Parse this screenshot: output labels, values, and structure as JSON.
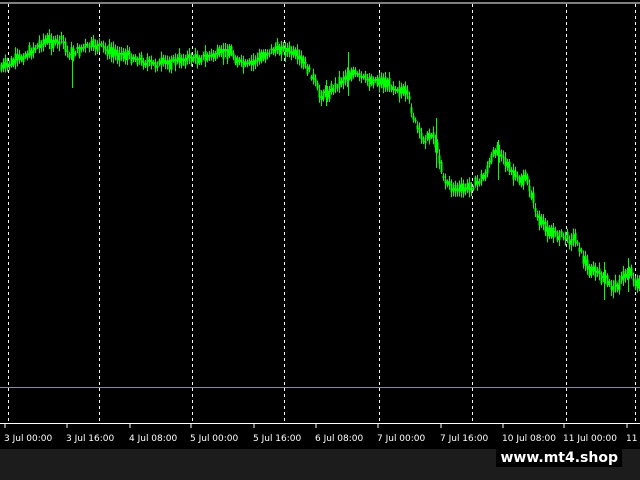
{
  "app": {
    "platform": "MetaTrader 4"
  },
  "chart": {
    "background": "#000000",
    "candle_color": "#00ff00",
    "grid_color": "#ffffff",
    "separator_color": "#8a8aa0",
    "time_labels": [
      "3 Jul 00:00",
      "3 Jul 16:00",
      "4 Jul 08:00",
      "5 Jul 00:00",
      "5 Jul 16:00",
      "6 Jul 08:00",
      "7 Jul 00:00",
      "7 Jul 16:00",
      "10 Jul 08:00",
      "11 Jul 00:00",
      "11 J"
    ]
  },
  "watermark": {
    "text": "www.mt4.shop"
  }
}
